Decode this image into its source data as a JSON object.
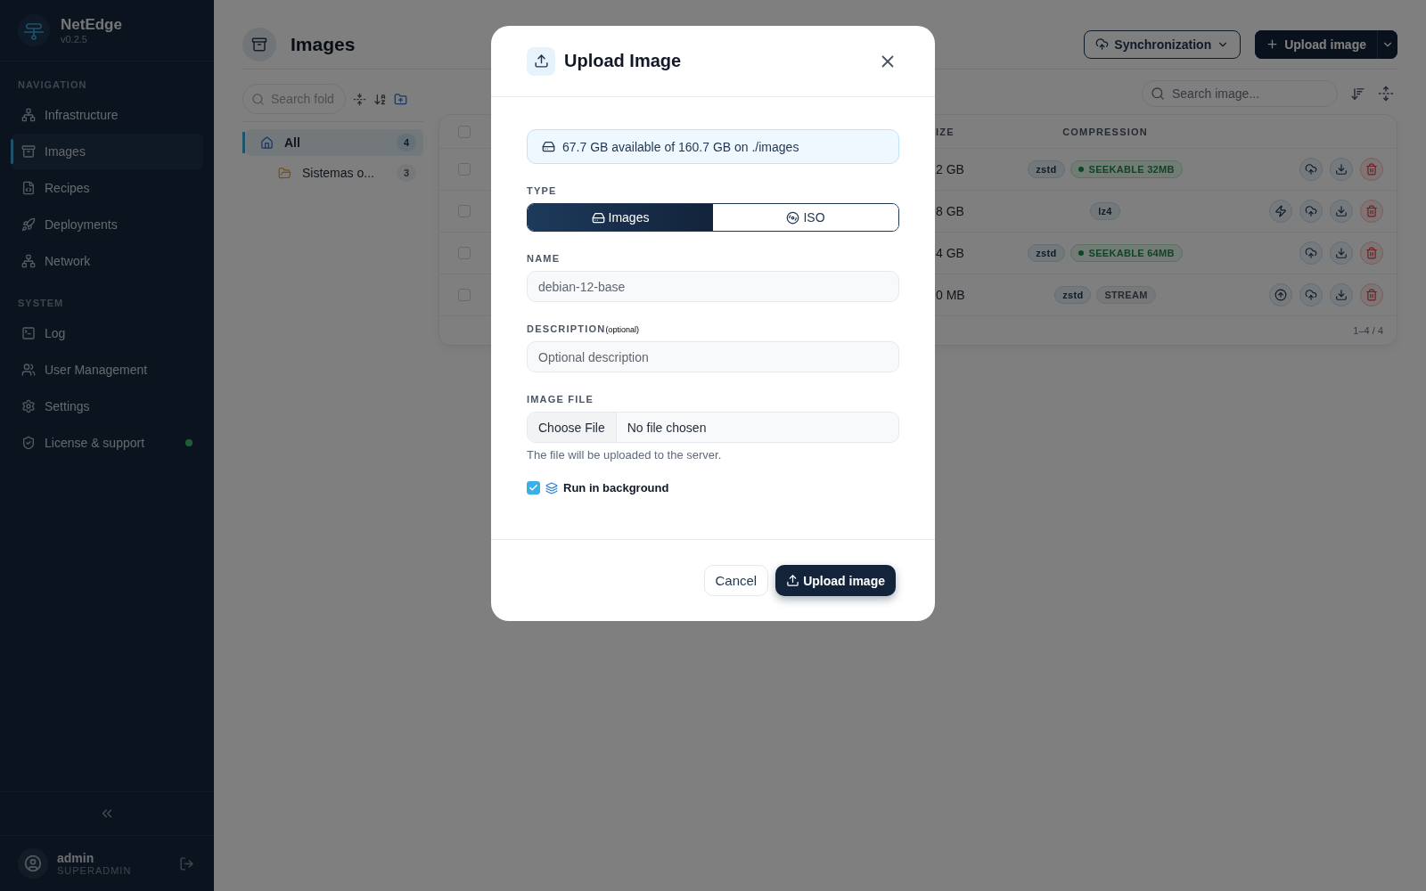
{
  "sidebar": {
    "brand": "NetEdge",
    "version": "v0.2.5",
    "sections": [
      {
        "title": "NAVIGATION",
        "items": [
          {
            "label": "Infrastructure",
            "selected": false,
            "dot": false
          },
          {
            "label": "Images",
            "selected": true,
            "dot": false
          },
          {
            "label": "Recipes",
            "selected": false,
            "dot": false
          },
          {
            "label": "Deployments",
            "selected": false,
            "dot": false
          },
          {
            "label": "Network",
            "selected": false,
            "dot": false
          }
        ]
      },
      {
        "title": "SYSTEM",
        "items": [
          {
            "label": "Log",
            "selected": false,
            "dot": false
          },
          {
            "label": "User Management",
            "selected": false,
            "dot": false
          },
          {
            "label": "Settings",
            "selected": false,
            "dot": false
          },
          {
            "label": "License & support",
            "selected": false,
            "dot": true
          }
        ]
      }
    ],
    "user": {
      "name": "admin",
      "role": "SUPERADMIN"
    }
  },
  "page": {
    "title": "Images",
    "sync_button": "Synchronization",
    "upload_button": "Upload image"
  },
  "folders": {
    "placeholder": "Search fold",
    "items": [
      {
        "label": "All",
        "count": "4",
        "kind": "home",
        "selected": true,
        "children": [
          {
            "label": "Sistemas o...",
            "count": "3",
            "kind": "folder",
            "selected": false
          }
        ]
      }
    ]
  },
  "images": {
    "placeholder": "Search image...",
    "all_checked": false,
    "columns": [
      "IZE",
      "COMPRESSION"
    ],
    "rows": [
      {
        "checked": false,
        "size": "2 GB",
        "tags": [
          {
            "label": "zstd",
            "kind": "codec"
          },
          {
            "label": "SEEKABLE 32MB",
            "kind": "seekable"
          }
        ],
        "actions": [
          {
            "kind": "cloud"
          },
          {
            "kind": "download"
          },
          {
            "kind": "delete"
          }
        ]
      },
      {
        "checked": false,
        "size": "8 GB",
        "tags": [
          {
            "label": "lz4",
            "kind": "codec"
          }
        ],
        "actions": [
          {
            "kind": "bolt"
          },
          {
            "kind": "cloud"
          },
          {
            "kind": "download"
          },
          {
            "kind": "delete"
          }
        ]
      },
      {
        "checked": false,
        "size": "4 GB",
        "tags": [
          {
            "label": "zstd",
            "kind": "codec"
          },
          {
            "label": "SEEKABLE 64MB",
            "kind": "seekable"
          }
        ],
        "actions": [
          {
            "kind": "cloud"
          },
          {
            "kind": "download"
          },
          {
            "kind": "delete"
          }
        ]
      },
      {
        "checked": false,
        "size": "0 MB",
        "tags": [
          {
            "label": "zstd",
            "kind": "codec"
          },
          {
            "label": "STREAM",
            "kind": "stream"
          }
        ],
        "actions": [
          {
            "kind": "push"
          },
          {
            "kind": "cloud"
          },
          {
            "kind": "download"
          },
          {
            "kind": "delete"
          }
        ]
      }
    ],
    "footer": "1–4 / 4"
  },
  "modal": {
    "title": "Upload Image",
    "storage": "67.7 GB available of 160.7 GB on ./images",
    "type_label": "TYPE",
    "types": [
      {
        "label": "Images",
        "selected": true
      },
      {
        "label": "ISO",
        "selected": false
      }
    ],
    "name_label": "NAME",
    "name_placeholder": "debian-12-base",
    "description_label": "DESCRIPTION",
    "description_note": "(optional)",
    "description_placeholder": "Optional description",
    "file_label": "IMAGE FILE",
    "file_button": "Choose File",
    "file_status": "No file chosen",
    "file_hint": "The file will be uploaded to the server.",
    "background": {
      "label": "Run in background",
      "checked": true
    },
    "cancel": "Cancel",
    "submit": "Upload image"
  }
}
